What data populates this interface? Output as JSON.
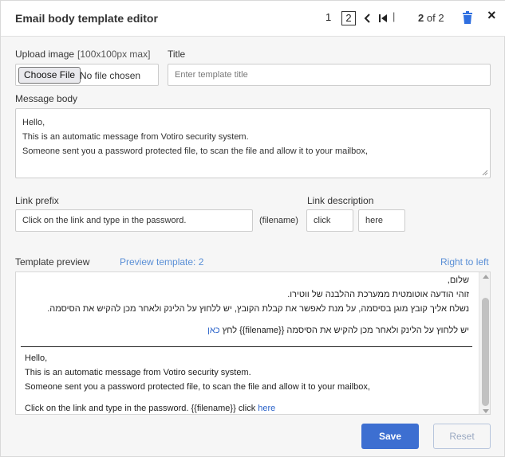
{
  "header": {
    "title": "Email body template editor",
    "pager": {
      "page_1": "1",
      "page_2": "2",
      "separator": "|",
      "current": "2",
      "of_text": "of 2"
    }
  },
  "form": {
    "upload": {
      "label": "Upload image",
      "hint": "[100x100px max]",
      "button_label": "Choose File",
      "status": "No file chosen"
    },
    "title": {
      "label": "Title",
      "placeholder": "Enter template title"
    },
    "message": {
      "label": "Message body",
      "lines": [
        "Hello,",
        "This is an automatic message from Votiro security system.",
        "Someone sent you a password protected file, to scan the file and allow it to your mailbox,"
      ]
    },
    "link_prefix": {
      "label": "Link prefix",
      "value": "Click on the link and type in the password."
    },
    "filename_token": "(filename)",
    "link_description": {
      "label": "Link description",
      "value_1": "click",
      "value_2": "here"
    }
  },
  "preview": {
    "label": "Template preview",
    "preview_link": "Preview template: 2",
    "direction_link": "Right to left",
    "rtl_lines": [
      "שלום,",
      "זוהי הודעה אוטומטית ממערכת ההלבנה של ווטירו.",
      "נשלח אליך קובץ מוגן בסיסמה, על מנת לאפשר את קבלת הקובץ, יש ללחוץ על הלינק ולאחר מכן להקיש את הסיסמה."
    ],
    "rtl_link_line": {
      "text": "יש ללחוץ על הלינק ולאחר מכן להקיש את הסיסמה {{filename}} לחץ",
      "link": "כאן"
    },
    "ltr_lines": [
      "Hello,",
      "This is an automatic message from Votiro security system.",
      "Someone sent you a password protected file, to scan the file and allow it to your mailbox,"
    ],
    "ltr_link_line": {
      "text": "Click on the link and type in the password. {{filename}} click",
      "link": "here"
    }
  },
  "actions": {
    "save": "Save",
    "reset": "Reset"
  },
  "colors": {
    "accent": "#3d6fd1",
    "link": "#5a8fd6",
    "trash": "#2f6fe0"
  },
  "icons": [
    "chevron-left-icon",
    "skip-first-icon",
    "trash-icon",
    "close-icon",
    "resize-grip-icon"
  ]
}
